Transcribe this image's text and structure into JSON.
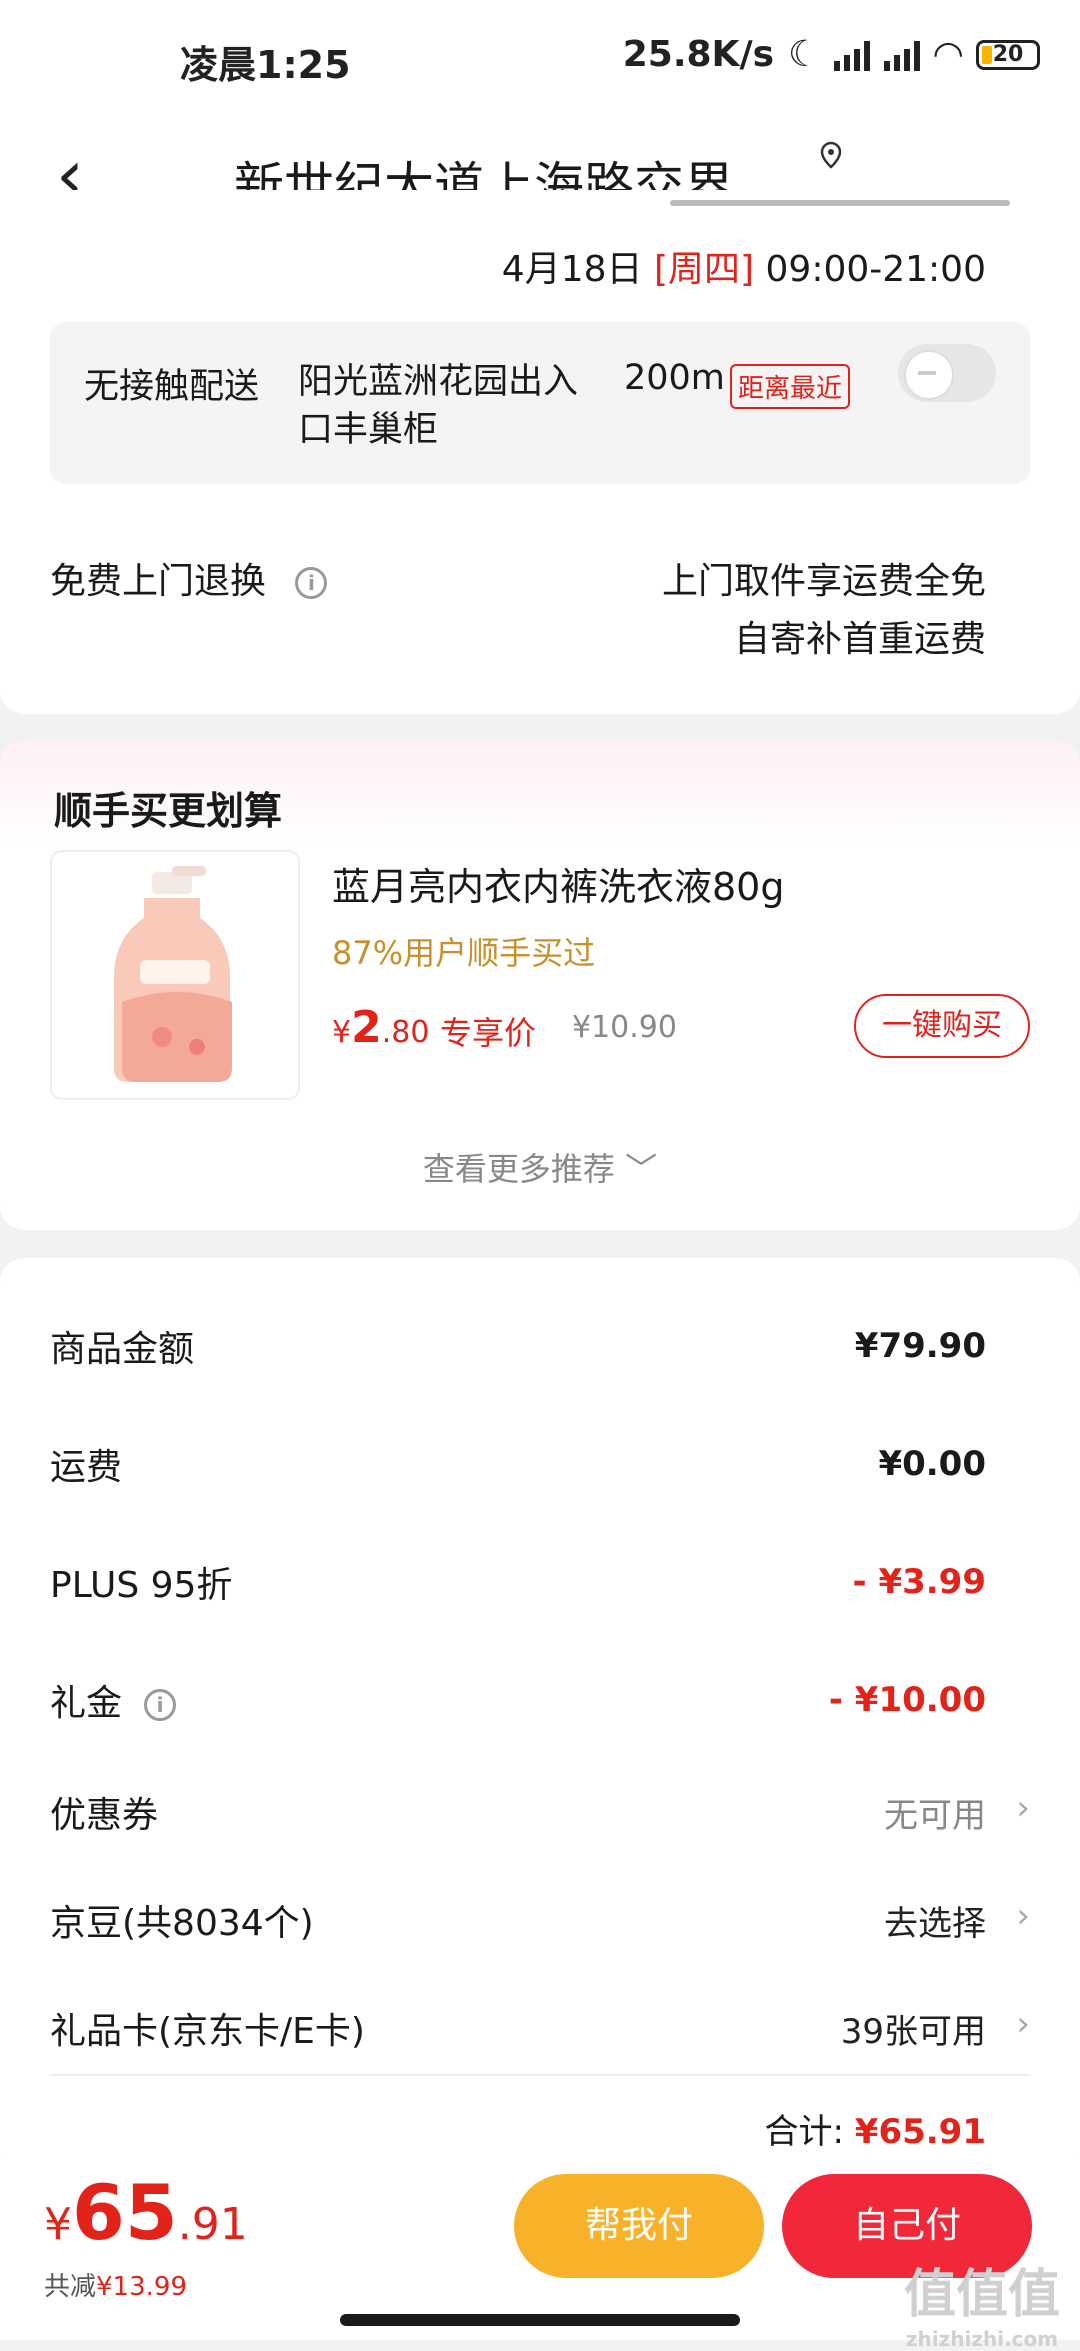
{
  "status": {
    "time": "凌晨1:25",
    "speed": "25.8K/s",
    "battery": "20"
  },
  "nav": {
    "back": "‹",
    "title": "新世纪大道上海路交界..."
  },
  "delivery": {
    "date_pre": "4月18日 ",
    "weekday": "[周四]",
    "time": " 09:00-21:00"
  },
  "locker": {
    "label": "无接触配送",
    "name": "阳光蓝洲花园出入口丰巢柜",
    "distance": "200m",
    "badge": "距离最近"
  },
  "returns": {
    "label": "免费上门退换",
    "line1": "上门取件享运费全免",
    "line2": "自寄补首重运费"
  },
  "recommend": {
    "title": "顺手买更划算",
    "product": {
      "name": "蓝月亮内衣内裤洗衣液80g",
      "pct": "87%用户顺手买过",
      "price_symbol": "¥",
      "price_int": "2",
      "price_dec": ".80",
      "special": "专享价",
      "orig": "¥10.90",
      "buy": "一键购买"
    },
    "more": "查看更多推荐 ﹀"
  },
  "summary": {
    "goods_label": "商品金额",
    "goods_val": "¥79.90",
    "ship_label": "运费",
    "ship_val": "¥0.00",
    "plus_label": "PLUS 95折",
    "plus_val": "- ¥3.99",
    "gift_label": "礼金",
    "gift_val": "- ¥10.00",
    "coupon_label": "优惠券",
    "coupon_val": "无可用",
    "beans_label": "京豆(共8034个)",
    "beans_val": "去选择",
    "card_label": "礼品卡(京东卡/E卡)",
    "card_val": "39张可用",
    "total_label": "合计:",
    "total_val": "¥65.91"
  },
  "bottom": {
    "symbol": "¥",
    "int": "65",
    "dec": ".91",
    "saved_label": "共减",
    "saved_val": "¥13.99",
    "help": "帮我付",
    "self": "自己付"
  },
  "watermark": {
    "text": "值值值",
    "sub": "zhizhizhi.com"
  }
}
